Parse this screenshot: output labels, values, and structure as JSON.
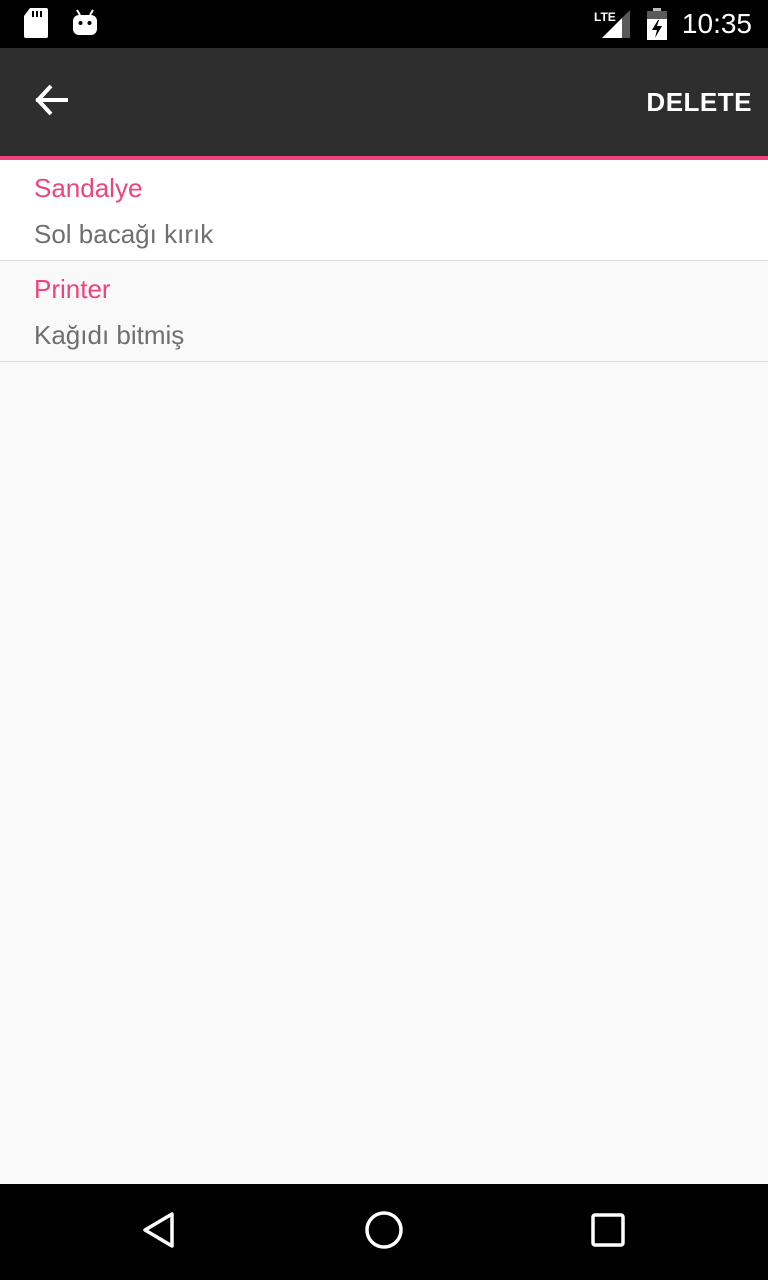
{
  "status_bar": {
    "time": "10:35",
    "network_label": "LTE",
    "icons": [
      "sd-card-icon",
      "android-icon",
      "lte-signal-icon",
      "battery-charging-icon"
    ]
  },
  "toolbar": {
    "back_icon": "arrow-back-icon",
    "delete_label": "DELETE",
    "background": "#2e2e2e",
    "accent": "#f0437a"
  },
  "list": {
    "items": [
      {
        "title": "Sandalye",
        "subtitle": "Sol bacağı kırık"
      },
      {
        "title": "Printer",
        "subtitle": "Kağıdı bitmiş"
      }
    ],
    "title_color": "#f0437a",
    "subtitle_color": "#6f6f6f"
  },
  "nav_bar": {
    "icons": [
      "back-triangle-icon",
      "home-circle-icon",
      "recents-square-icon"
    ]
  }
}
